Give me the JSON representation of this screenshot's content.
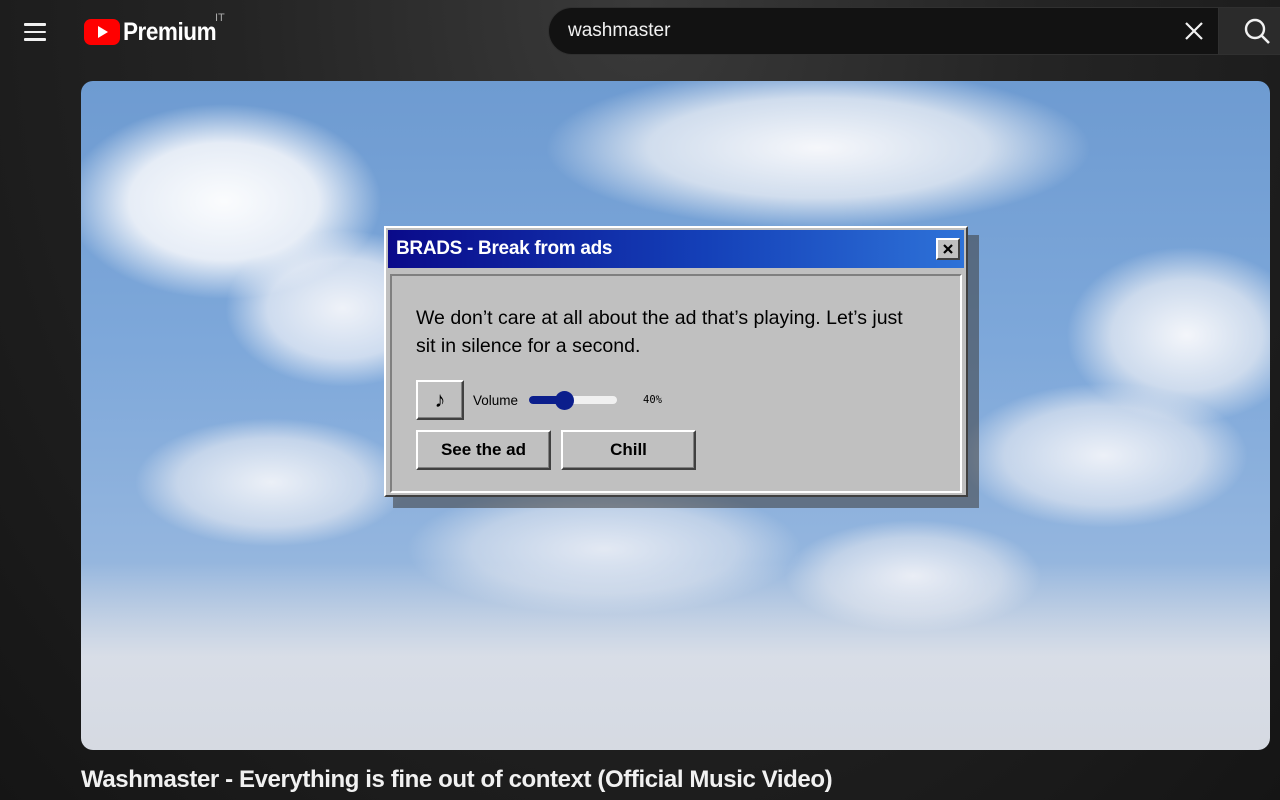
{
  "header": {
    "logo_text": "Premium",
    "country_code": "IT",
    "search": {
      "value": "washmaster",
      "placeholder": "Search"
    },
    "brand_color": "#ff0000"
  },
  "dialog": {
    "title": "BRADS - Break from ads",
    "close_label": "×",
    "message": "We don’t care at all about the ad that’s playing. Let’s just sit in silence for a second.",
    "music_label": "♪",
    "volume_label": "Volume",
    "volume_percent": 40,
    "volume_text": "40%",
    "see_ad_label": "See the ad",
    "chill_label": "Chill",
    "title_gradient": [
      "#0a0a8a",
      "#2e72d8"
    ]
  },
  "video": {
    "title": "Washmaster - Everything is fine out of context (Official Music Video)"
  }
}
